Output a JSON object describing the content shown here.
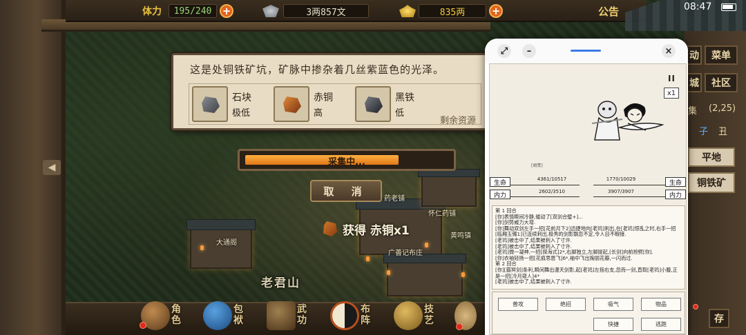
{
  "topbar": {
    "stamina_label": "体力",
    "stamina_value": "195/240",
    "silver_value": "3两857文",
    "gold_value": "835两",
    "notice_label": "公告",
    "plus_symbol": "+"
  },
  "status_bar": {
    "time": "08:47"
  },
  "mine": {
    "description": "这是处铜铁矿坑，矿脉中掺杂着几丝紫蓝色的光泽。",
    "items": [
      {
        "name": "石块",
        "grade": "极低",
        "color": "#5a5e62"
      },
      {
        "name": "赤铜",
        "grade": "高",
        "color": "#b45a1e"
      },
      {
        "name": "黑铁",
        "grade": "低",
        "color": "#3a3c40"
      }
    ],
    "remaining_label": "剩余资源"
  },
  "gather": {
    "progress_label": "采集中...",
    "progress_fraction": 0.78,
    "cancel_label": "取 消"
  },
  "gain_text": "获得 赤铜x1",
  "map": {
    "area_name": "老君山",
    "labels": [
      "药老铺",
      "怀仁药铺",
      "大通阁",
      "黄鸣镇",
      "广善记布庄"
    ]
  },
  "bottom_menu": [
    {
      "label": "角色",
      "icon": "hat-icon",
      "color": "#8a5a30"
    },
    {
      "label": "包袱",
      "icon": "bag-icon",
      "color": "#2e6aa0"
    },
    {
      "label": "武功",
      "icon": "book-icon",
      "color": "#6a5030"
    },
    {
      "label": "布阵",
      "icon": "taiji-icon",
      "color": "#a0401a"
    },
    {
      "label": "技艺",
      "icon": "teapot-icon",
      "color": "#9a7a30"
    }
  ],
  "right_panel": {
    "btn_activity": "动",
    "btn_menu": "菜单",
    "btn_life": "城",
    "btn_community": "社区",
    "gather_text": "集",
    "coords": "(2,25)",
    "hour_zi": "子",
    "hour_chou": "丑",
    "terrain": "平地",
    "mine_name": "铜铁矿",
    "save": "存"
  },
  "battle": {
    "pause": "II",
    "speed": "x1",
    "enemy_name": "[胡青]",
    "hp_label": "生命",
    "mp_label": "内力",
    "player_hp": "4361/10517",
    "player_mp": "2602/3510",
    "enemy_hp": "1770/10029",
    "enemy_mp": "3907/3907",
    "log": [
      "第 1 回合",
      "[你]表情瞬间冷静,催动了[双剑合璧+]...",
      "[你]剑势威力大增.",
      "[你]舞动双剑左手一招[花前月下2]迅捷地向[老鸨]刺出,在[老鸨]惊乱之时,右手一招[临厢玉镯1]已连续刺出,极秀的剑影飘忽不定,令人目不暇接.",
      "[老鸨]被击中了,结果被刺入了寸许.",
      "[老鸨]被击中了,结果被刺入了寸许.",
      "[老鸨]微一凝神,一招[探海式]2*,右脚独立,左脚提起,[长剑]向前抢劈[你].",
      "[你]衣袖轻扬一招[花痕思恩飞]6*,袖中飞出掬丽花瓣,一闪而过.",
      "第 2 回合",
      "[你][霸冥剑]条利,瞬间舞出漫天剑影,起[老鸨]左指右支,忽而一剑,直取[老鸨]小腹,正是一招[冷月窥人]4*",
      "[老鸨]被击中了,结果被刺入了寸许."
    ],
    "actions": {
      "attack": "普攻",
      "skill": "绝招",
      "absorb": "吸气",
      "item": "物品",
      "fast": "快捷",
      "escape": "逃跑"
    }
  },
  "popup_buttons": {
    "minus": "–",
    "close": "×"
  }
}
